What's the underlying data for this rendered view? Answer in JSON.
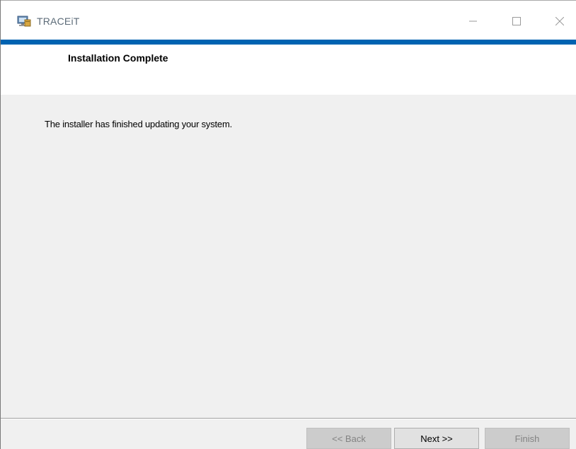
{
  "window": {
    "title": "TRACEiT",
    "app_icon": "installer-icon",
    "controls": [
      "minimize-icon",
      "maximize-icon",
      "close-icon"
    ]
  },
  "banner": {
    "title": "Installation Complete"
  },
  "content": {
    "message": "The installer has finished updating your system."
  },
  "footer": {
    "back_label": "<< Back",
    "next_label": "Next >>",
    "finish_label": "Finish"
  },
  "colors": {
    "accent": "#0063b1",
    "content_bg": "#f0f0f0"
  }
}
